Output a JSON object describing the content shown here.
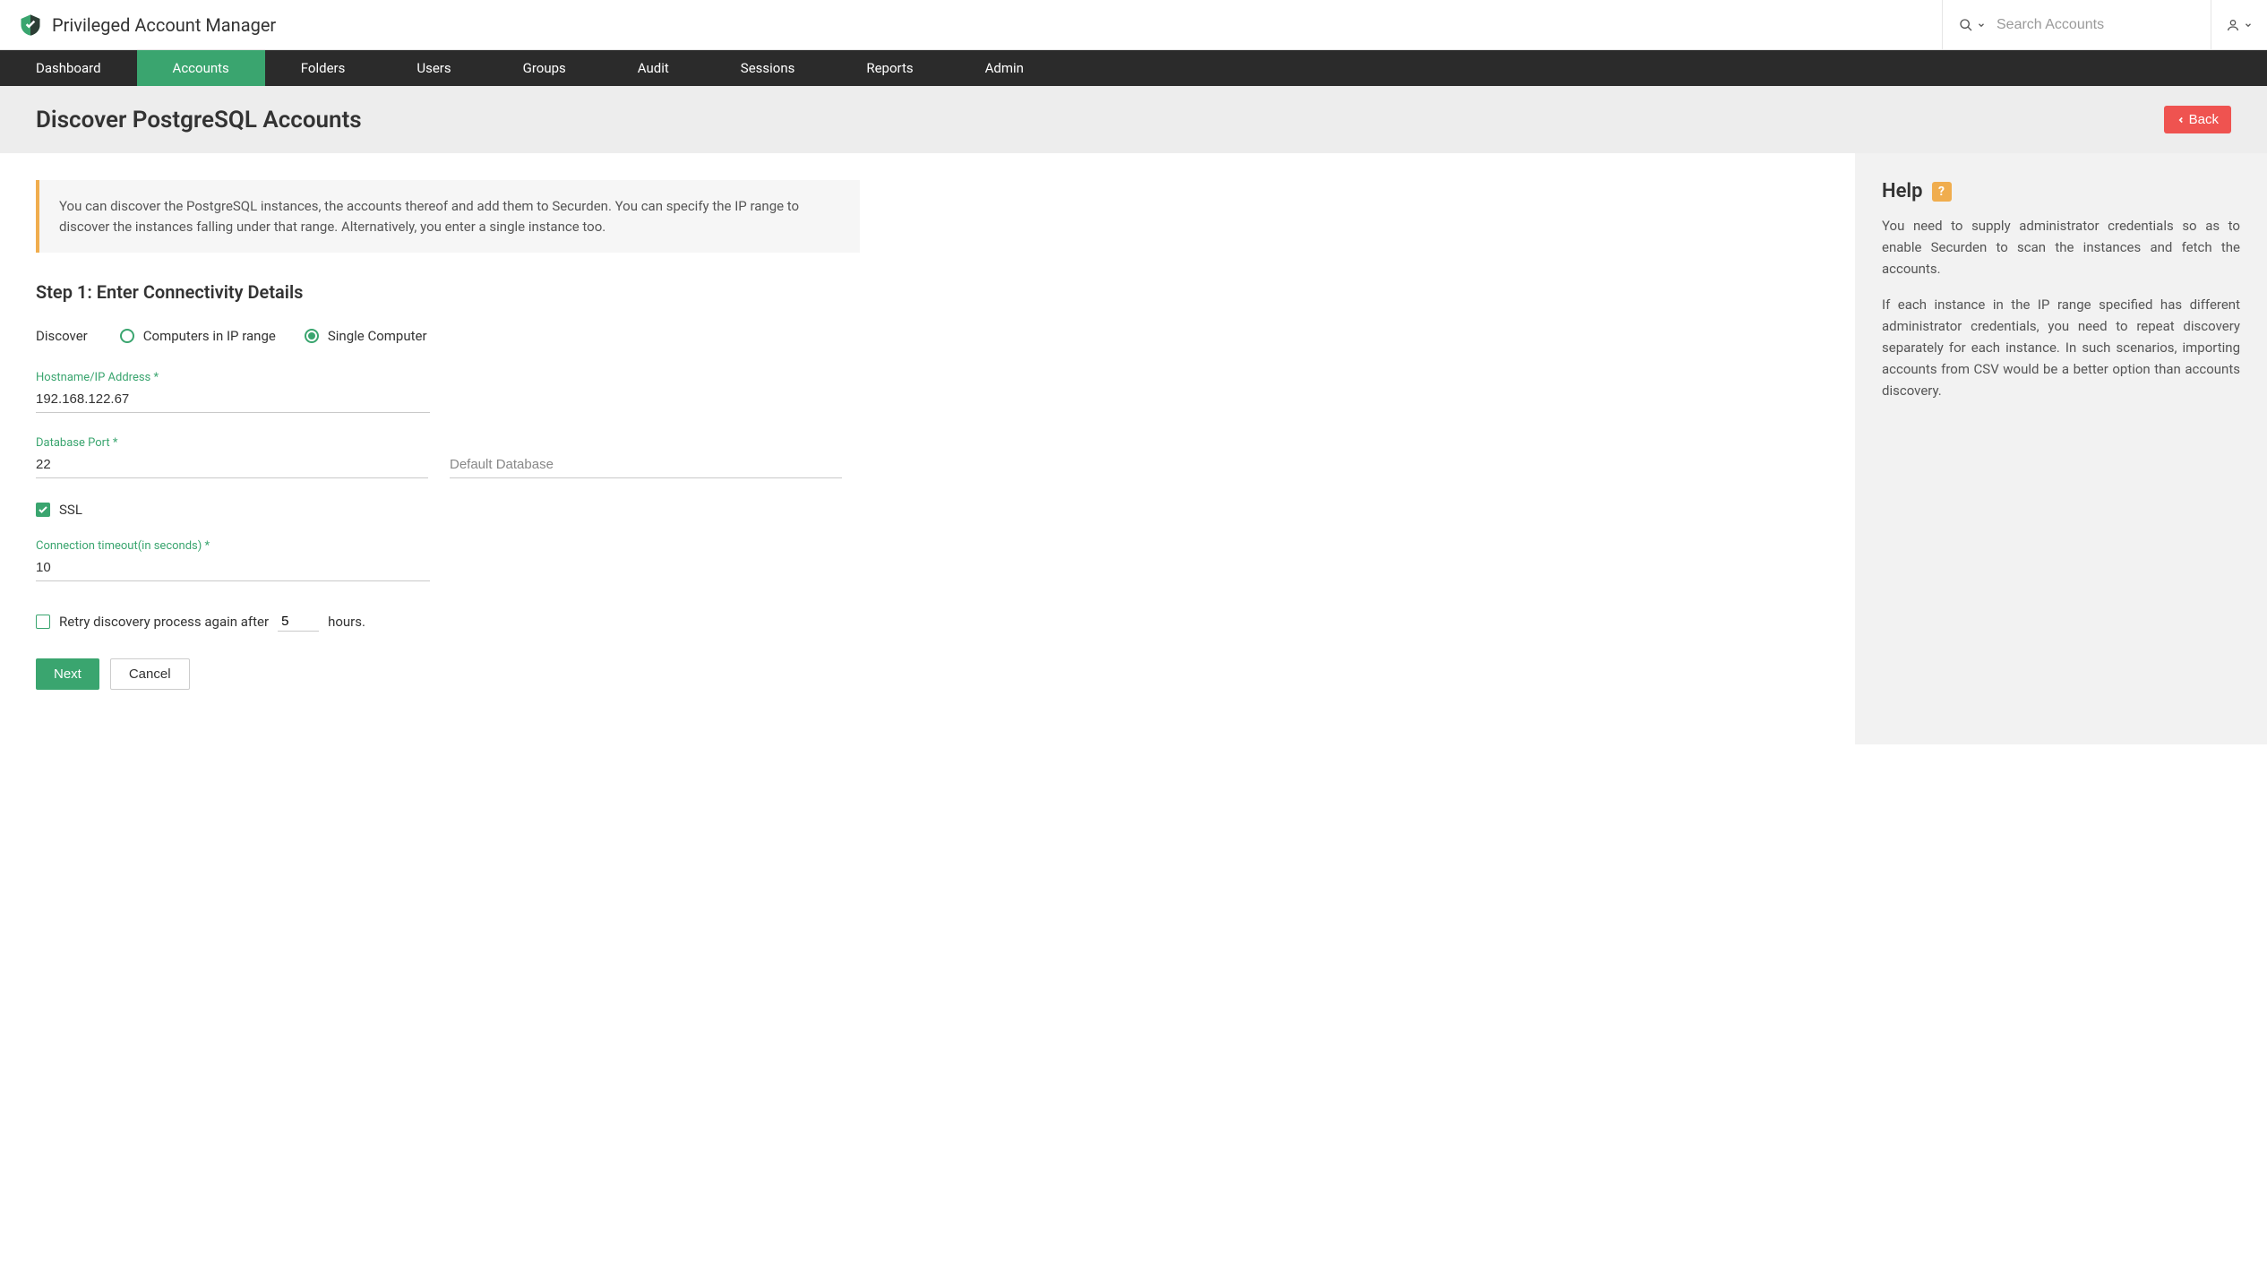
{
  "brand": {
    "title": "Privileged Account Manager"
  },
  "search": {
    "placeholder": "Search Accounts"
  },
  "nav": {
    "items": [
      {
        "label": "Dashboard",
        "active": false
      },
      {
        "label": "Accounts",
        "active": true
      },
      {
        "label": "Folders",
        "active": false
      },
      {
        "label": "Users",
        "active": false
      },
      {
        "label": "Groups",
        "active": false
      },
      {
        "label": "Audit",
        "active": false
      },
      {
        "label": "Sessions",
        "active": false
      },
      {
        "label": "Reports",
        "active": false
      },
      {
        "label": "Admin",
        "active": false
      }
    ]
  },
  "page": {
    "title": "Discover PostgreSQL Accounts",
    "back": "Back"
  },
  "banner": "You can discover the PostgreSQL instances, the accounts thereof and add them to Securden. You can specify the IP range to discover the instances falling under that range. Alternatively, you enter a single instance too.",
  "step_title": "Step 1: Enter Connectivity Details",
  "discover": {
    "lead": "Discover",
    "opt_range": "Computers in IP range",
    "opt_single": "Single Computer",
    "selected": "single"
  },
  "fields": {
    "hostname": {
      "label": "Hostname/IP Address *",
      "value": "192.168.122.67"
    },
    "port": {
      "label": "Database Port *",
      "value": "22"
    },
    "defaultdb": {
      "placeholder": "Default Database",
      "value": ""
    },
    "ssl": {
      "label": "SSL",
      "checked": true
    },
    "timeout": {
      "label": "Connection timeout(in seconds) *",
      "value": "10"
    }
  },
  "retry": {
    "checked": false,
    "text_before": "Retry discovery process again after",
    "value": "5",
    "text_after": "hours."
  },
  "buttons": {
    "next": "Next",
    "cancel": "Cancel"
  },
  "help": {
    "title": "Help",
    "p1": "You need to supply administrator credentials so as to enable Securden to scan the instances and fetch the accounts.",
    "p2": "If each instance in the IP range specified has different administrator credentials, you need to repeat discovery separately for each instance. In such scenarios, importing accounts from CSV would be a better option than accounts discovery."
  }
}
